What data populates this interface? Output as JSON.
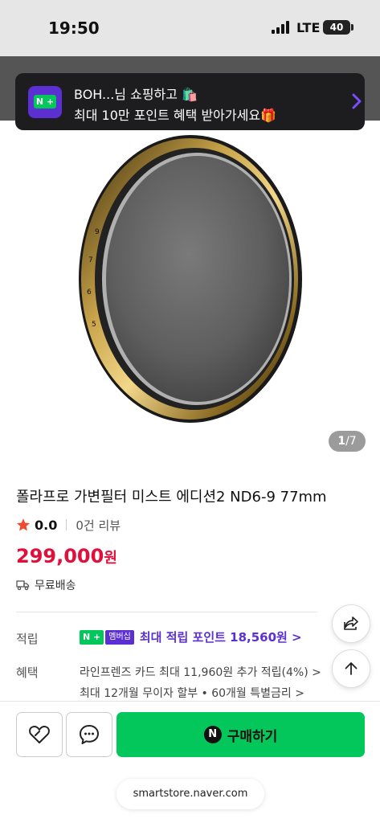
{
  "status_bar": {
    "time": "19:50",
    "network": "LTE",
    "battery": "40"
  },
  "banner": {
    "logo_text": "N +",
    "line1": "BOH...님 쇼핑하고 🛍️",
    "line2": "최대 10만 포인트 혜택 받아가세요🎁"
  },
  "gallery": {
    "current": "1",
    "total": "/7"
  },
  "product": {
    "title": "폴라프로 가변필터 미스트 에디션2 ND6-9 77mm",
    "rating": "0.0",
    "reviews": "0건 리뷰",
    "price": "299,000",
    "price_unit": "원",
    "shipping": "무료배송"
  },
  "points": {
    "label": "적립",
    "npay_badge": "N +",
    "membership_badge": "멤버십",
    "text": "최대 적립 포인트 18,560원 >"
  },
  "benefits": {
    "label": "혜택",
    "line1": "라인프렌즈 카드 최대 11,960원 추가 적립(4%) >",
    "line2": "최대 12개월 무이자 할부 • 60개월 특별금리 >"
  },
  "actions": {
    "buy_label": "구매하기",
    "buy_icon_text": "N"
  },
  "browser": {
    "url": "smartstore.naver.com"
  },
  "colors": {
    "accent_green": "#03c75a",
    "price_red": "#e0103a",
    "membership_purple": "#5b2fd1"
  }
}
